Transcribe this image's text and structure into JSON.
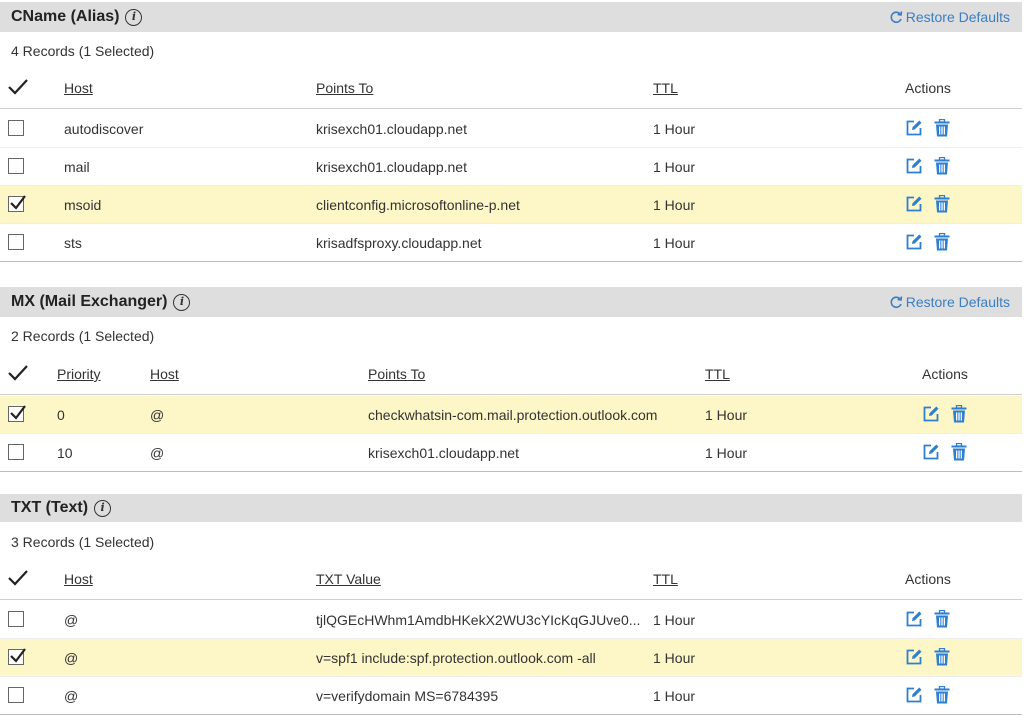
{
  "sections": {
    "cname": {
      "title": "CName (Alias)",
      "restore": "Restore Defaults",
      "count": "4 Records (1 Selected)",
      "headers": {
        "host": "Host",
        "points_to": "Points To",
        "ttl": "TTL",
        "actions": "Actions"
      },
      "rows": [
        {
          "host": "autodiscover",
          "points_to": "krisexch01.cloudapp.net",
          "ttl": "1 Hour",
          "selected": false
        },
        {
          "host": "mail",
          "points_to": "krisexch01.cloudapp.net",
          "ttl": "1 Hour",
          "selected": false
        },
        {
          "host": "msoid",
          "points_to": "clientconfig.microsoftonline-p.net",
          "ttl": "1 Hour",
          "selected": true
        },
        {
          "host": "sts",
          "points_to": "krisadfsproxy.cloudapp.net",
          "ttl": "1 Hour",
          "selected": false
        }
      ]
    },
    "mx": {
      "title": "MX (Mail Exchanger)",
      "restore": "Restore Defaults",
      "count": "2 Records (1 Selected)",
      "headers": {
        "priority": "Priority",
        "host": "Host",
        "points_to": "Points To",
        "ttl": "TTL",
        "actions": "Actions"
      },
      "rows": [
        {
          "priority": "0",
          "host": "@",
          "points_to": "checkwhatsin-com.mail.protection.outlook.com",
          "ttl": "1 Hour",
          "selected": true
        },
        {
          "priority": "10",
          "host": "@",
          "points_to": "krisexch01.cloudapp.net",
          "ttl": "1 Hour",
          "selected": false
        }
      ]
    },
    "txt": {
      "title": "TXT (Text)",
      "count": "3 Records (1 Selected)",
      "headers": {
        "host": "Host",
        "txt_value": "TXT Value",
        "ttl": "TTL",
        "actions": "Actions"
      },
      "rows": [
        {
          "host": "@",
          "txt_value": "tjlQGEcHWhm1AmdbHKekX2WU3cYIcKqGJUve0...",
          "ttl": "1 Hour",
          "selected": false
        },
        {
          "host": "@",
          "txt_value": "v=spf1 include:spf.protection.outlook.com -all",
          "ttl": "1 Hour",
          "selected": true
        },
        {
          "host": "@",
          "txt_value": "v=verifydomain MS=6784395",
          "ttl": "1 Hour",
          "selected": false
        }
      ]
    }
  },
  "icons": {
    "info": "i",
    "edit": "edit-icon",
    "delete": "trash-icon",
    "restore": "refresh-icon",
    "check": "checkmark-icon"
  },
  "colors": {
    "accent": "#2f7fd1",
    "selected_row": "#fdf6c6",
    "header_bg": "#dedede"
  }
}
